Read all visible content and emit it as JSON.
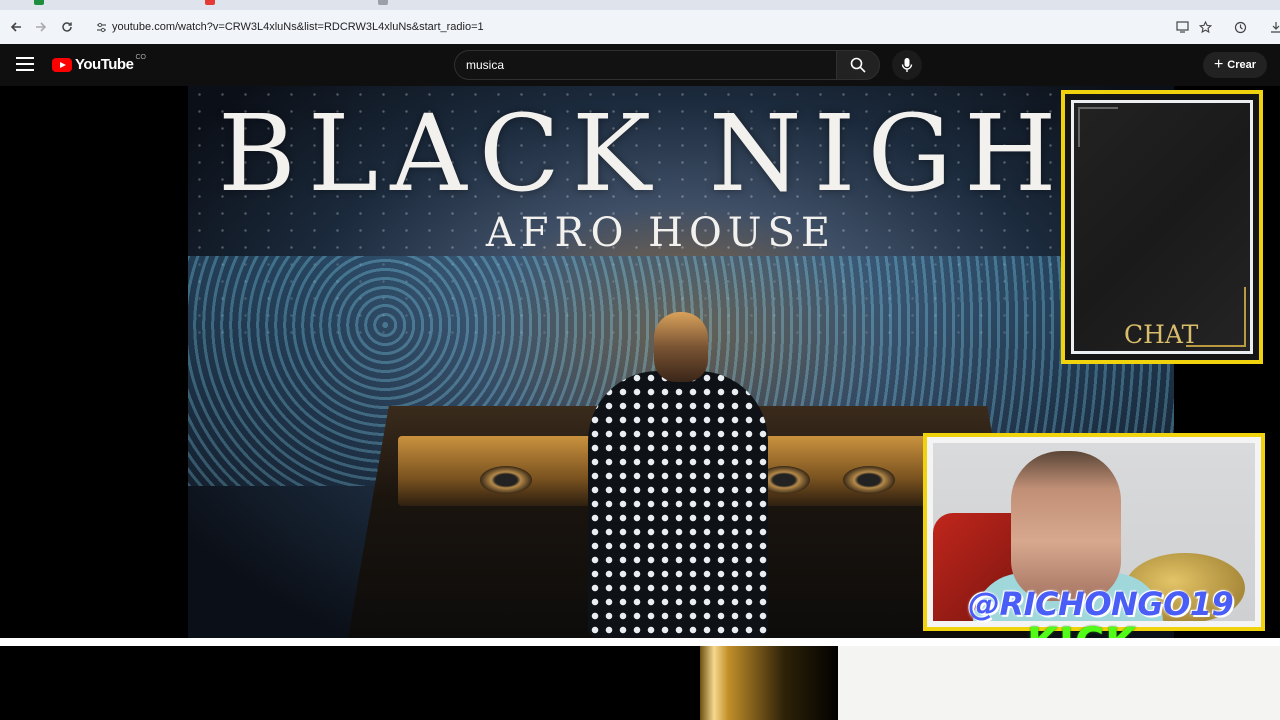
{
  "browser": {
    "url": "youtube.com/watch?v=CRW3L4xluNs&list=RDCRW3L4xluNs&start_radio=1",
    "icons": {
      "back": "arrow-left-icon",
      "forward": "arrow-right-icon",
      "reload": "reload-icon",
      "site_info": "tune-icon",
      "install": "install-app-icon",
      "bookmark": "star-icon",
      "history": "history-icon",
      "download": "download-icon"
    }
  },
  "youtube": {
    "logo_text": "YouTube",
    "country_code": "CO",
    "search_value": "musica",
    "create_label": "Crear",
    "brand_color": "#ff0000"
  },
  "video": {
    "title_main": "BLACK NIGHT",
    "title_sub": "AFRO HOUSE"
  },
  "overlay": {
    "chat_label": "CHAT",
    "handle": "@RICHONGO19",
    "kick_label": "KICK",
    "frame_color": "#f0d30c",
    "kick_color": "#53fc18"
  }
}
